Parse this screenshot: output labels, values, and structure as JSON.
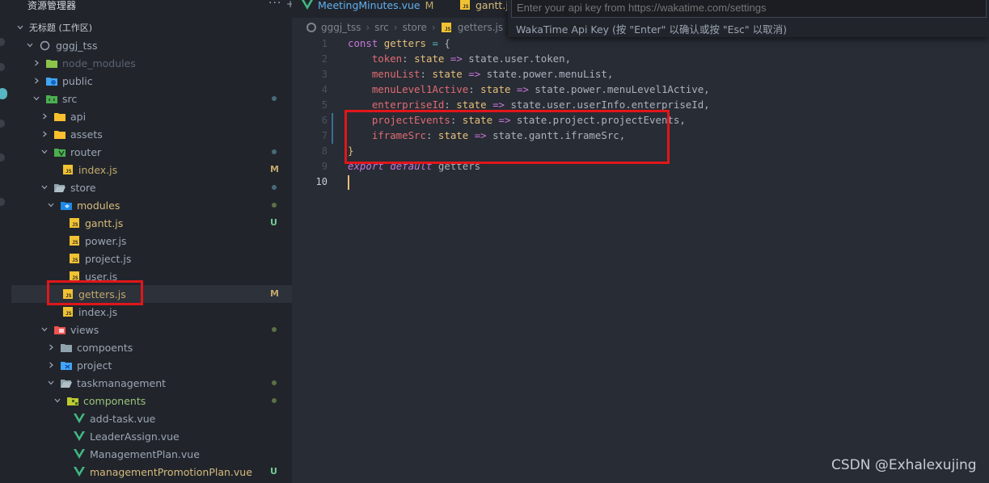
{
  "sidebar": {
    "title": "资源管理器",
    "workspace": "无标题 (工作区)",
    "items": [
      {
        "label": "gggj_tss",
        "badge": ""
      },
      {
        "label": "node_modules",
        "badge": ""
      },
      {
        "label": "public",
        "badge": ""
      },
      {
        "label": "src",
        "badge": ""
      },
      {
        "label": "api",
        "badge": ""
      },
      {
        "label": "assets",
        "badge": ""
      },
      {
        "label": "router",
        "badge": ""
      },
      {
        "label": "index.js",
        "badge": "M"
      },
      {
        "label": "store",
        "badge": ""
      },
      {
        "label": "modules",
        "badge": ""
      },
      {
        "label": "gantt.js",
        "badge": "U"
      },
      {
        "label": "power.js",
        "badge": ""
      },
      {
        "label": "project.js",
        "badge": ""
      },
      {
        "label": "user.js",
        "badge": ""
      },
      {
        "label": "getters.js",
        "badge": "M"
      },
      {
        "label": "index.js",
        "badge": ""
      },
      {
        "label": "views",
        "badge": ""
      },
      {
        "label": "compoents",
        "badge": ""
      },
      {
        "label": "project",
        "badge": ""
      },
      {
        "label": "taskmanagement",
        "badge": ""
      },
      {
        "label": "components",
        "badge": ""
      },
      {
        "label": "add-task.vue",
        "badge": ""
      },
      {
        "label": "LeaderAssign.vue",
        "badge": ""
      },
      {
        "label": "ManagementPlan.vue",
        "badge": ""
      },
      {
        "label": "managementPromotionPlan.vue",
        "badge": "U"
      }
    ]
  },
  "tabs": [
    {
      "label": "MeetingMinutes.vue",
      "badge": "M"
    },
    {
      "label": "gantt.js",
      "badge": ""
    }
  ],
  "breadcrumb": [
    "gggj_tss",
    "src",
    "store",
    "getters.js"
  ],
  "palette": {
    "placeholder": "Enter your api key from https://wakatime.com/settings",
    "hint": "WakaTime Api Key (按 \"Enter\" 以确认或按 \"Esc\" 以取消)"
  },
  "code": {
    "line_numbers": [
      "1",
      "2",
      "3",
      "4",
      "5",
      "6",
      "7",
      "8",
      "9",
      "10"
    ],
    "l1": [
      "const",
      "getters",
      "=",
      "{"
    ],
    "l2": [
      "token",
      "state",
      "=>",
      "state.user.token,"
    ],
    "l3": [
      "menuList",
      "state",
      "=>",
      "state.power.menuList,"
    ],
    "l4": [
      "menuLevel1Active",
      "state",
      "=>",
      "state.power.menuLevel1Active,"
    ],
    "l5": [
      "enterpriseId",
      "state",
      "=>",
      "state.user.userInfo.enterpriseId,"
    ],
    "l6": [
      "projectEvents",
      "state",
      "=>",
      "state.project.projectEvents,"
    ],
    "l7": [
      "iframeSrc",
      "state",
      "=>",
      "state.gantt.iframeSrc,"
    ],
    "l8": "}",
    "l9": [
      "export",
      "default",
      "getters"
    ]
  },
  "watermark": "CSDN @Exhalexujing"
}
